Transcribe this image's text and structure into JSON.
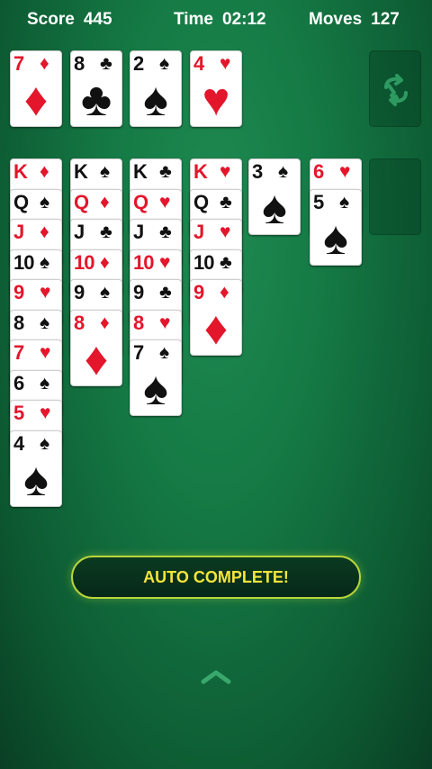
{
  "status": {
    "score_label": "Score",
    "score": "445",
    "time_label": "Time",
    "time": "02:12",
    "moves_label": "Moves",
    "moves": "127"
  },
  "foundations": [
    {
      "rank": "7",
      "suit": "♦",
      "color": "red"
    },
    {
      "rank": "8",
      "suit": "♣",
      "color": "black"
    },
    {
      "rank": "2",
      "suit": "♠",
      "color": "black"
    },
    {
      "rank": "4",
      "suit": "♥",
      "color": "red"
    }
  ],
  "stock": {
    "icon": "recycle-icon",
    "empty": true
  },
  "tableau": [
    [
      {
        "rank": "K",
        "suit": "♦",
        "color": "red"
      },
      {
        "rank": "Q",
        "suit": "♠",
        "color": "black"
      },
      {
        "rank": "J",
        "suit": "♦",
        "color": "red"
      },
      {
        "rank": "10",
        "suit": "♠",
        "color": "black"
      },
      {
        "rank": "9",
        "suit": "♥",
        "color": "red"
      },
      {
        "rank": "8",
        "suit": "♠",
        "color": "black"
      },
      {
        "rank": "7",
        "suit": "♥",
        "color": "red"
      },
      {
        "rank": "6",
        "suit": "♠",
        "color": "black"
      },
      {
        "rank": "5",
        "suit": "♥",
        "color": "red"
      },
      {
        "rank": "4",
        "suit": "♠",
        "color": "black"
      }
    ],
    [
      {
        "rank": "K",
        "suit": "♠",
        "color": "black"
      },
      {
        "rank": "Q",
        "suit": "♦",
        "color": "red"
      },
      {
        "rank": "J",
        "suit": "♣",
        "color": "black"
      },
      {
        "rank": "10",
        "suit": "♦",
        "color": "red"
      },
      {
        "rank": "9",
        "suit": "♠",
        "color": "black"
      },
      {
        "rank": "8",
        "suit": "♦",
        "color": "red"
      }
    ],
    [
      {
        "rank": "K",
        "suit": "♣",
        "color": "black"
      },
      {
        "rank": "Q",
        "suit": "♥",
        "color": "red"
      },
      {
        "rank": "J",
        "suit": "♣",
        "color": "black"
      },
      {
        "rank": "10",
        "suit": "♥",
        "color": "red"
      },
      {
        "rank": "9",
        "suit": "♣",
        "color": "black"
      },
      {
        "rank": "8",
        "suit": "♥",
        "color": "red"
      },
      {
        "rank": "7",
        "suit": "♠",
        "color": "black"
      }
    ],
    [
      {
        "rank": "K",
        "suit": "♥",
        "color": "red"
      },
      {
        "rank": "Q",
        "suit": "♣",
        "color": "black"
      },
      {
        "rank": "J",
        "suit": "♥",
        "color": "red"
      },
      {
        "rank": "10",
        "suit": "♣",
        "color": "black"
      },
      {
        "rank": "9",
        "suit": "♦",
        "color": "red"
      }
    ],
    [
      {
        "rank": "3",
        "suit": "♠",
        "color": "black"
      }
    ],
    [
      {
        "rank": "6",
        "suit": "♥",
        "color": "red"
      },
      {
        "rank": "5",
        "suit": "♠",
        "color": "black"
      }
    ],
    []
  ],
  "auto_complete_label": "AUTO COMPLETE!",
  "menu_icon": "chevron-up-icon",
  "colors": {
    "felt": "#157a45",
    "red_suit": "#e3162b",
    "button_border": "#b9d63a",
    "button_text": "#f5e53a"
  }
}
